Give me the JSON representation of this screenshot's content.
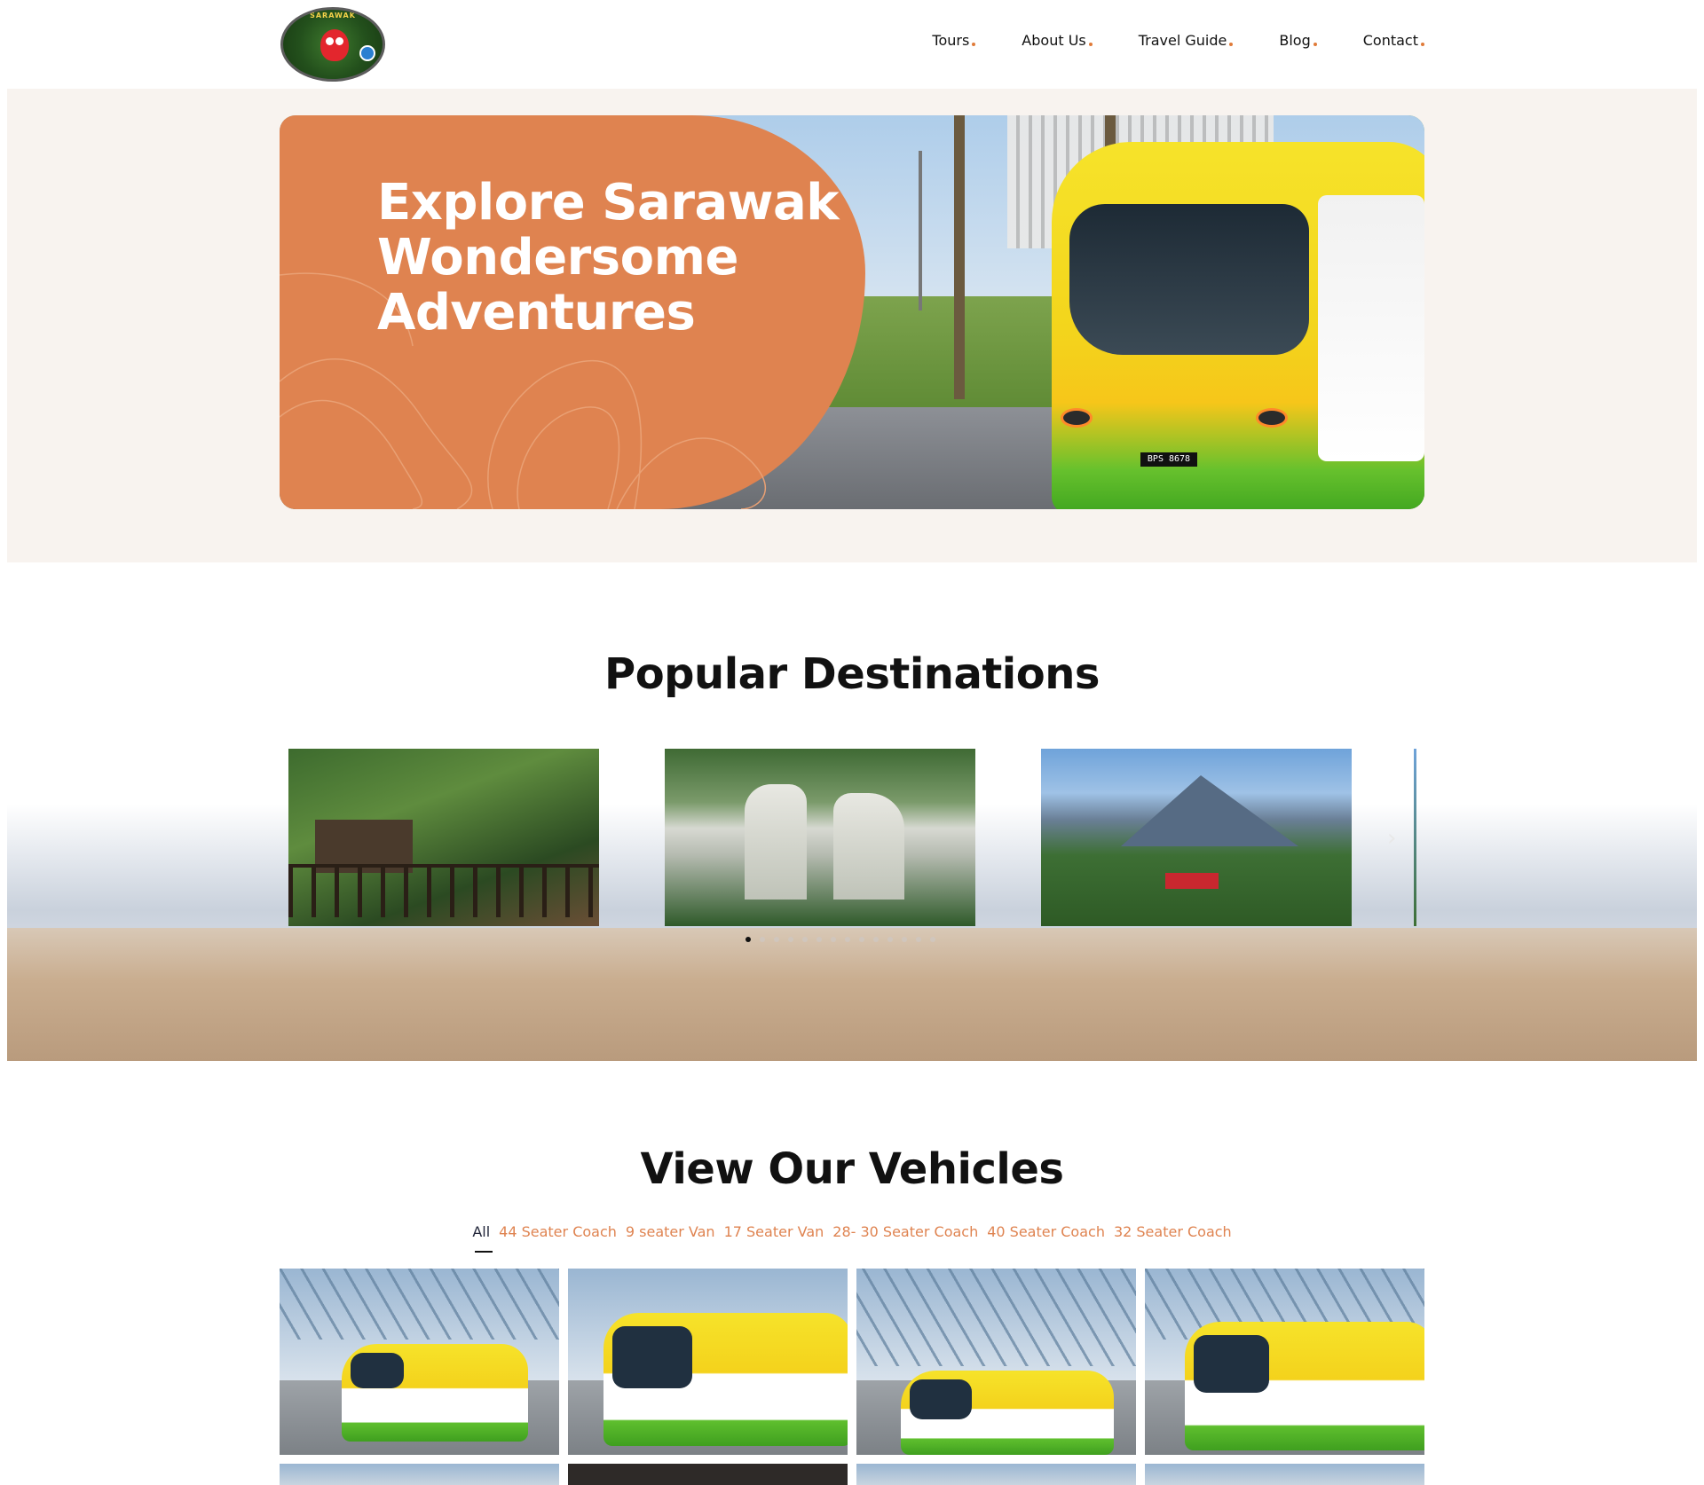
{
  "brand": {
    "logo_alt": "Sarawak Borneo logo",
    "logo_ring_text": "SARAWAK"
  },
  "nav": {
    "items": [
      {
        "label": "Tours"
      },
      {
        "label": "About Us"
      },
      {
        "label": "Travel Guide"
      },
      {
        "label": "Blog"
      },
      {
        "label": "Contact"
      }
    ]
  },
  "hero": {
    "title_line1": "Explore Sarawak",
    "title_line2": "Wondersome",
    "title_line3": "Adventures",
    "bus_plate": "BPS 8678"
  },
  "destinations": {
    "title": "Popular Destinations",
    "cards": [
      {
        "alt": "rainforest lodge boardwalk"
      },
      {
        "alt": "limestone cave valley"
      },
      {
        "alt": "mountain resort view"
      }
    ],
    "pagination": {
      "total_dots": 14,
      "active_index": 0
    }
  },
  "vehicles": {
    "title": "View Our Vehicles",
    "filters": [
      {
        "label": "All",
        "active": true
      },
      {
        "label": "44 Seater Coach",
        "active": false
      },
      {
        "label": "9 seater Van",
        "active": false
      },
      {
        "label": "17 Seater Van",
        "active": false
      },
      {
        "label": "28- 30 Seater Coach",
        "active": false
      },
      {
        "label": "40 Seater Coach",
        "active": false
      },
      {
        "label": "32 Seater Coach",
        "active": false
      }
    ]
  },
  "colors": {
    "accent": "#df8350",
    "hero_bg": "#f8f3ef",
    "text_dark": "#111111"
  },
  "icons": {
    "nav_dot": "dot-icon",
    "carousel_next": "chevron-right-icon"
  }
}
